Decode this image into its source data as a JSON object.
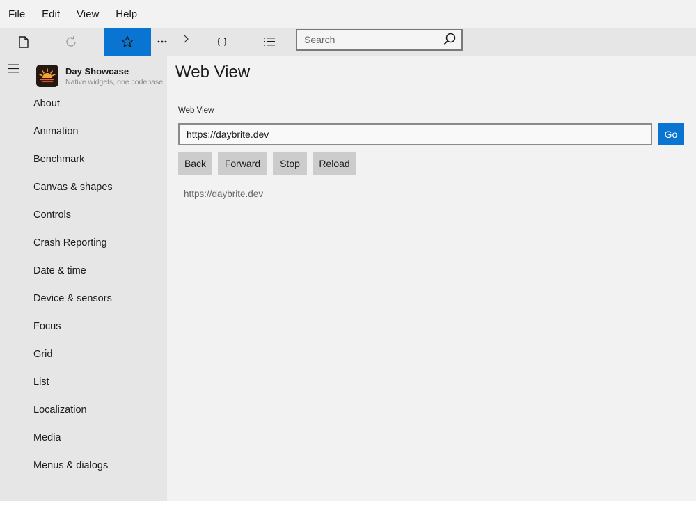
{
  "menubar": {
    "items": [
      "File",
      "Edit",
      "View",
      "Help"
    ]
  },
  "toolbar": {
    "buttons": [
      {
        "icon": "new-document-icon",
        "active": false
      },
      {
        "icon": "refresh-icon",
        "active": false,
        "disabled": true
      },
      {
        "icon": "favorite-star-icon",
        "active": true
      },
      {
        "icon": "more-icon",
        "active": false
      },
      {
        "icon": "chevron-right-icon",
        "active": false
      },
      {
        "icon": "braces-icon",
        "active": false
      },
      {
        "icon": "list-icon",
        "active": false
      }
    ],
    "search": {
      "placeholder": "Search",
      "value": ""
    }
  },
  "sidebar": {
    "app_name": "Day Showcase",
    "app_tagline": "Native widgets, one codebase",
    "items": [
      "About",
      "Animation",
      "Benchmark",
      "Canvas & shapes",
      "Controls",
      "Crash Reporting",
      "Date & time",
      "Device & sensors",
      "Focus",
      "Grid",
      "List",
      "Localization",
      "Media",
      "Menus & dialogs"
    ]
  },
  "main": {
    "title": "Web View",
    "field_label": "Web View",
    "url_value": "https://daybrite.dev",
    "go_label": "Go",
    "buttons": {
      "back": "Back",
      "forward": "Forward",
      "stop": "Stop",
      "reload": "Reload"
    },
    "current_url": "https://daybrite.dev"
  },
  "colors": {
    "accent": "#0a74d2",
    "sidebar_bg": "#e6e6e6",
    "main_bg": "#f2f2f2"
  }
}
